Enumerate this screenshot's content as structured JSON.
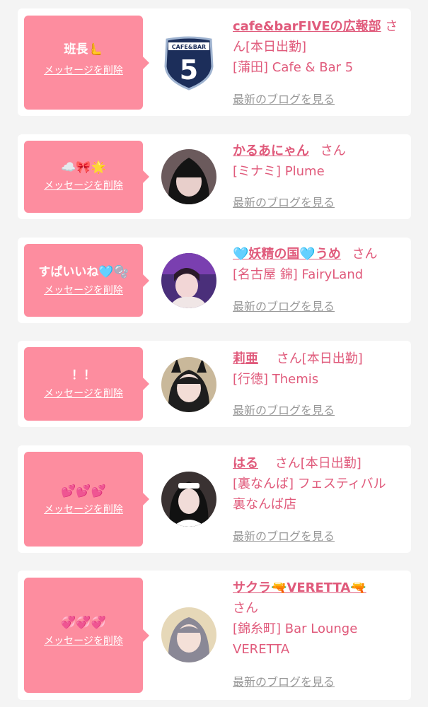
{
  "delete_label": "メッセージを削除",
  "blog_label": "最新のブログを見る",
  "san": "さん",
  "cards": [
    {
      "message": "班長🫷",
      "name": "cafe&barFIVEの広報部",
      "status": "[本日出勤]",
      "shop": "[蒲田] Cafe & Bar 5",
      "logo_top": "CAFE&BAR",
      "logo_num": "5"
    },
    {
      "message": "☁️🎀🌟",
      "name": "かるあにゃん",
      "status": "",
      "shop": "[ミナミ] Plume"
    },
    {
      "message": "すぱいいね🩵🫧",
      "name": "🩵妖精の国🩵うめ",
      "status": "",
      "shop": "[名古屋 錦] FairyLand"
    },
    {
      "message": "！！",
      "name": "莉亜",
      "status": "[本日出勤]",
      "shop": "[行徳] Themis"
    },
    {
      "message": "💕💕💕",
      "name": "はる",
      "status": "[本日出勤]",
      "shop": "[裏なんば] フェスティバル 裏なんば店"
    },
    {
      "message": "💞💞💞",
      "name": "サクラ🔫VERETTA🔫",
      "status": "",
      "shop": "[錦糸町] Bar Lounge VERETTA"
    }
  ],
  "colors": {
    "accent": "#fd8d9f",
    "link": "#e05a7b",
    "muted": "#999999"
  }
}
